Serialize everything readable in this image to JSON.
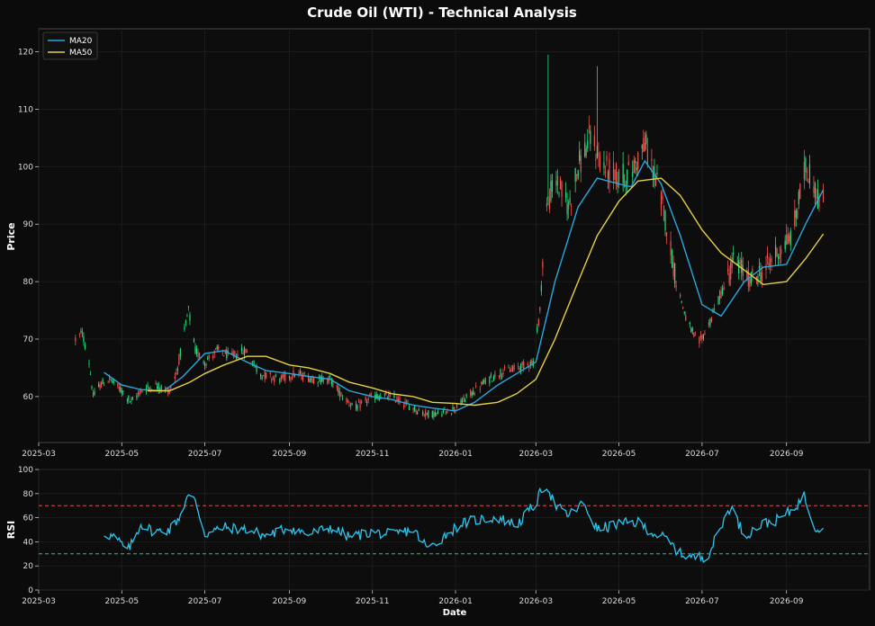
{
  "chart_data": [
    {
      "type": "candlestick",
      "title": "Crude Oil (WTI) - Technical Analysis",
      "xlabel": "",
      "ylabel": "Price",
      "ylim": [
        52,
        124
      ],
      "xlim": [
        "2025-03-01",
        "2026-11-01"
      ],
      "yticks": [
        60,
        70,
        80,
        90,
        100,
        110,
        120
      ],
      "xticks": [
        "2025-03",
        "2025-05",
        "2025-07",
        "2025-09",
        "2025-11",
        "2026-01",
        "2026-03",
        "2026-05",
        "2026-07",
        "2026-09"
      ],
      "grid": true,
      "legend_position": "top-left",
      "colors": {
        "up": "#26e07f",
        "down": "#ef5350",
        "ma20": "#29a8e0",
        "ma50": "#e6d040"
      },
      "price_anchors": [
        [
          "2025-03-28",
          70
        ],
        [
          "2025-04-02",
          71
        ],
        [
          "2025-04-07",
          66
        ],
        [
          "2025-04-10",
          60
        ],
        [
          "2025-04-15",
          62
        ],
        [
          "2025-04-22",
          63
        ],
        [
          "2025-05-01",
          61
        ],
        [
          "2025-05-08",
          59
        ],
        [
          "2025-05-15",
          61
        ],
        [
          "2025-05-25",
          62
        ],
        [
          "2025-06-05",
          61
        ],
        [
          "2025-06-10",
          64
        ],
        [
          "2025-06-15",
          70
        ],
        [
          "2025-06-19",
          75
        ],
        [
          "2025-06-24",
          68
        ],
        [
          "2025-07-01",
          66
        ],
        [
          "2025-07-10",
          68
        ],
        [
          "2025-07-20",
          67
        ],
        [
          "2025-07-31",
          68
        ],
        [
          "2025-08-10",
          64
        ],
        [
          "2025-08-25",
          63
        ],
        [
          "2025-09-05",
          64
        ],
        [
          "2025-09-20",
          63
        ],
        [
          "2025-10-01",
          63
        ],
        [
          "2025-10-10",
          60
        ],
        [
          "2025-10-20",
          58
        ],
        [
          "2025-11-01",
          60
        ],
        [
          "2025-11-15",
          60
        ],
        [
          "2025-12-01",
          58
        ],
        [
          "2025-12-10",
          57
        ],
        [
          "2025-12-20",
          57
        ],
        [
          "2026-01-01",
          58
        ],
        [
          "2026-01-10",
          60
        ],
        [
          "2026-01-20",
          62
        ],
        [
          "2026-02-01",
          64
        ],
        [
          "2026-02-15",
          65
        ],
        [
          "2026-02-27",
          66
        ],
        [
          "2026-03-04",
          75
        ],
        [
          "2026-03-08",
          92
        ],
        [
          "2026-03-15",
          98
        ],
        [
          "2026-03-25",
          93
        ],
        [
          "2026-04-01",
          100
        ],
        [
          "2026-04-10",
          105
        ],
        [
          "2026-04-20",
          100
        ],
        [
          "2026-05-01",
          98
        ],
        [
          "2026-05-10",
          99
        ],
        [
          "2026-05-20",
          104
        ],
        [
          "2026-05-28",
          98
        ],
        [
          "2026-06-05",
          90
        ],
        [
          "2026-06-12",
          80
        ],
        [
          "2026-06-20",
          73
        ],
        [
          "2026-06-28",
          69
        ],
        [
          "2026-07-05",
          72
        ],
        [
          "2026-07-15",
          78
        ],
        [
          "2026-07-25",
          84
        ],
        [
          "2026-08-05",
          80
        ],
        [
          "2026-08-15",
          82
        ],
        [
          "2026-08-25",
          85
        ],
        [
          "2026-09-05",
          88
        ],
        [
          "2026-09-15",
          100
        ],
        [
          "2026-09-20",
          98
        ],
        [
          "2026-09-25",
          94
        ],
        [
          "2026-09-28",
          94
        ]
      ],
      "spikes": [
        {
          "date": "2025-06-21",
          "high": 78
        },
        {
          "date": "2026-03-10",
          "high": 119.5
        },
        {
          "date": "2026-04-15",
          "high": 117.5
        }
      ],
      "series": [
        {
          "name": "MA20",
          "color": "#29a8e0",
          "points": [
            [
              "2025-04-18",
              64.2
            ],
            [
              "2025-05-01",
              62
            ],
            [
              "2025-05-15",
              61.2
            ],
            [
              "2025-06-01",
              61
            ],
            [
              "2025-06-15",
              63.5
            ],
            [
              "2025-07-01",
              67.5
            ],
            [
              "2025-07-15",
              68
            ],
            [
              "2025-08-01",
              66
            ],
            [
              "2025-08-15",
              64.5
            ],
            [
              "2025-09-01",
              64
            ],
            [
              "2025-09-15",
              63.5
            ],
            [
              "2025-10-01",
              63
            ],
            [
              "2025-10-15",
              61
            ],
            [
              "2025-11-01",
              60
            ],
            [
              "2025-11-15",
              59.5
            ],
            [
              "2025-12-01",
              58.5
            ],
            [
              "2025-12-15",
              58
            ],
            [
              "2026-01-01",
              57.5
            ],
            [
              "2026-01-15",
              59
            ],
            [
              "2026-02-01",
              62
            ],
            [
              "2026-02-15",
              64
            ],
            [
              "2026-03-01",
              66
            ],
            [
              "2026-03-15",
              80
            ],
            [
              "2026-04-01",
              93
            ],
            [
              "2026-04-15",
              98
            ],
            [
              "2026-05-01",
              97
            ],
            [
              "2026-05-10",
              96.5
            ],
            [
              "2026-05-20",
              101
            ],
            [
              "2026-06-01",
              97
            ],
            [
              "2026-06-15",
              88
            ],
            [
              "2026-07-01",
              76
            ],
            [
              "2026-07-15",
              74
            ],
            [
              "2026-08-01",
              80
            ],
            [
              "2026-08-15",
              82.5
            ],
            [
              "2026-09-01",
              83
            ],
            [
              "2026-09-15",
              90
            ],
            [
              "2026-09-28",
              96
            ]
          ]
        },
        {
          "name": "MA50",
          "color": "#e6d040",
          "points": [
            [
              "2025-05-20",
              61
            ],
            [
              "2025-06-05",
              61
            ],
            [
              "2025-06-20",
              62.5
            ],
            [
              "2025-07-01",
              64
            ],
            [
              "2025-07-15",
              65.5
            ],
            [
              "2025-08-01",
              67
            ],
            [
              "2025-08-15",
              67
            ],
            [
              "2025-09-01",
              65.5
            ],
            [
              "2025-09-15",
              65
            ],
            [
              "2025-10-01",
              64
            ],
            [
              "2025-10-15",
              62.5
            ],
            [
              "2025-11-01",
              61.5
            ],
            [
              "2025-11-15",
              60.5
            ],
            [
              "2025-12-01",
              60
            ],
            [
              "2025-12-15",
              59
            ],
            [
              "2026-01-01",
              58.8
            ],
            [
              "2026-01-15",
              58.5
            ],
            [
              "2026-02-01",
              59
            ],
            [
              "2026-02-15",
              60.5
            ],
            [
              "2026-03-01",
              63
            ],
            [
              "2026-03-15",
              70
            ],
            [
              "2026-04-01",
              80
            ],
            [
              "2026-04-15",
              88
            ],
            [
              "2026-05-01",
              94
            ],
            [
              "2026-05-15",
              97.5
            ],
            [
              "2026-06-01",
              98
            ],
            [
              "2026-06-15",
              95
            ],
            [
              "2026-07-01",
              89
            ],
            [
              "2026-07-15",
              85
            ],
            [
              "2026-08-01",
              82
            ],
            [
              "2026-08-15",
              79.5
            ],
            [
              "2026-09-01",
              80
            ],
            [
              "2026-09-15",
              84
            ],
            [
              "2026-09-28",
              88.3
            ]
          ]
        }
      ]
    },
    {
      "type": "line",
      "title": "",
      "xlabel": "Date",
      "ylabel": "RSI",
      "ylim": [
        0,
        100
      ],
      "xlim": [
        "2025-03-01",
        "2026-11-01"
      ],
      "yticks": [
        0,
        20,
        40,
        60,
        80,
        100
      ],
      "xticks": [
        "2025-03",
        "2025-05",
        "2025-07",
        "2025-09",
        "2025-11",
        "2026-01",
        "2026-03",
        "2026-05",
        "2026-07",
        "2026-09"
      ],
      "grid": true,
      "reference_lines": [
        {
          "value": 70,
          "color": "#e05050"
        },
        {
          "value": 30,
          "color": "#30c07a"
        }
      ],
      "series": [
        {
          "name": "RSI",
          "color": "#2ec4ec",
          "points": [
            [
              "2025-04-18",
              47
            ],
            [
              "2025-04-25",
              44
            ],
            [
              "2025-05-01",
              38
            ],
            [
              "2025-05-05",
              32
            ],
            [
              "2025-05-10",
              42
            ],
            [
              "2025-05-15",
              55
            ],
            [
              "2025-05-25",
              48
            ],
            [
              "2025-06-05",
              50
            ],
            [
              "2025-06-12",
              60
            ],
            [
              "2025-06-18",
              77
            ],
            [
              "2025-06-24",
              75
            ],
            [
              "2025-07-01",
              46
            ],
            [
              "2025-07-15",
              52
            ],
            [
              "2025-08-01",
              50
            ],
            [
              "2025-08-15",
              45
            ],
            [
              "2025-09-01",
              52
            ],
            [
              "2025-09-15",
              46
            ],
            [
              "2025-10-01",
              52
            ],
            [
              "2025-10-15",
              44
            ],
            [
              "2025-11-01",
              48
            ],
            [
              "2025-11-15",
              46
            ],
            [
              "2025-12-01",
              50
            ],
            [
              "2025-12-12",
              34
            ],
            [
              "2025-12-25",
              46
            ],
            [
              "2026-01-05",
              55
            ],
            [
              "2026-01-15",
              58
            ],
            [
              "2026-02-01",
              60
            ],
            [
              "2026-02-15",
              54
            ],
            [
              "2026-03-01",
              72
            ],
            [
              "2026-03-08",
              90
            ],
            [
              "2026-03-15",
              70
            ],
            [
              "2026-03-25",
              62
            ],
            [
              "2026-04-05",
              72
            ],
            [
              "2026-04-15",
              50
            ],
            [
              "2026-05-01",
              55
            ],
            [
              "2026-05-15",
              56
            ],
            [
              "2026-05-25",
              48
            ],
            [
              "2026-06-05",
              42
            ],
            [
              "2026-06-15",
              30
            ],
            [
              "2026-06-25",
              27
            ],
            [
              "2026-07-05",
              28
            ],
            [
              "2026-07-12",
              45
            ],
            [
              "2026-07-22",
              70
            ],
            [
              "2026-08-01",
              45
            ],
            [
              "2026-08-15",
              55
            ],
            [
              "2026-08-25",
              58
            ],
            [
              "2026-09-05",
              66
            ],
            [
              "2026-09-14",
              78
            ],
            [
              "2026-09-22",
              52
            ],
            [
              "2026-09-28",
              52
            ]
          ]
        }
      ]
    }
  ]
}
